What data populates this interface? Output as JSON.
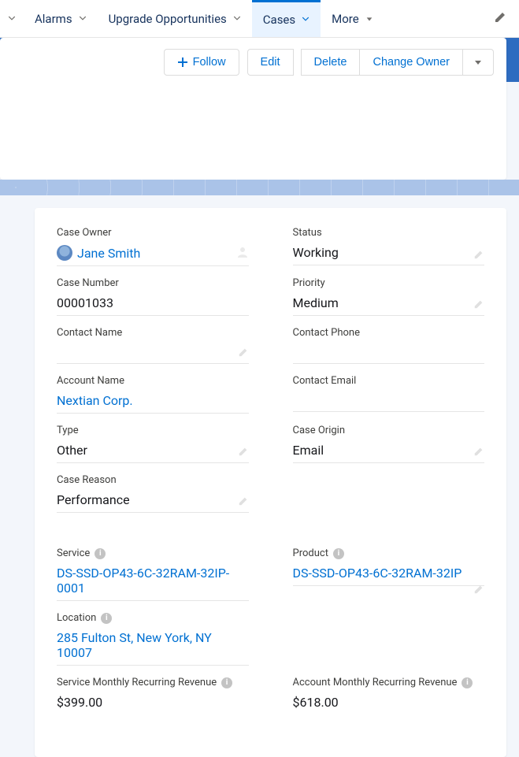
{
  "nav": {
    "items": [
      {
        "label": "Alarms"
      },
      {
        "label": "Upgrade Opportunities"
      },
      {
        "label": "Cases",
        "active": true
      },
      {
        "label": "More"
      }
    ]
  },
  "actions": {
    "follow": "Follow",
    "edit": "Edit",
    "delete": "Delete",
    "change_owner": "Change Owner"
  },
  "fields": {
    "left": [
      {
        "label": "Case Owner",
        "value": "Jane Smith",
        "link": true,
        "avatar": true,
        "ownerGhost": true
      },
      {
        "label": "Case Number",
        "value": "00001033"
      },
      {
        "label": "Contact Name",
        "value": "",
        "pencil": true
      },
      {
        "label": "Account Name",
        "value": "Nextian Corp.",
        "link": true
      },
      {
        "label": "Type",
        "value": "Other",
        "pencil": true
      },
      {
        "label": "Case Reason",
        "value": "Performance",
        "pencil": true
      }
    ],
    "right": [
      {
        "label": "Status",
        "value": "Working",
        "pencil": true
      },
      {
        "label": "Priority",
        "value": "Medium",
        "pencil": true
      },
      {
        "label": "Contact Phone",
        "value": ""
      },
      {
        "label": "Contact Email",
        "value": ""
      },
      {
        "label": "Case Origin",
        "value": "Email",
        "pencil": true
      },
      {
        "label": "",
        "value": "",
        "empty": true
      }
    ],
    "left2": [
      {
        "label": "Service",
        "value": "DS-SSD-OP43-6C-32RAM-32IP-0001",
        "link": true,
        "info": true
      },
      {
        "label": "Location",
        "value": "285 Fulton St, New York, NY 10007",
        "link": true,
        "info": true
      },
      {
        "label": "Service Monthly Recurring Revenue",
        "value": "$399.00",
        "info": true,
        "noborder": true
      }
    ],
    "right2": [
      {
        "label": "Product",
        "value": "DS-SSD-OP43-6C-32RAM-32IP",
        "link": true,
        "info": true,
        "pencil": true
      },
      {
        "label": "",
        "value": "",
        "empty": true
      },
      {
        "label": "Account Monthly Recurring Revenue",
        "value": "$618.00",
        "info": true,
        "noborder": true
      }
    ]
  }
}
